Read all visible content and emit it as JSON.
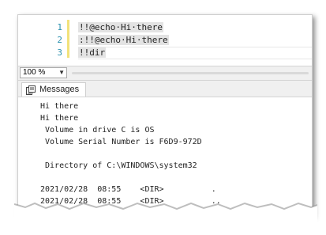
{
  "editor": {
    "line_numbers": [
      "1",
      "2",
      "3"
    ],
    "lines": [
      "!!@echo·Hi·there",
      ":!!@echo·Hi·there",
      "!!dir"
    ]
  },
  "zoom": {
    "value": "100 %"
  },
  "tabs": [
    {
      "label": "Messages",
      "icon": "messages-icon"
    }
  ],
  "output": {
    "lines": [
      "Hi there",
      "Hi there",
      " Volume in drive C is OS",
      " Volume Serial Number is F6D9-972D",
      "",
      " Directory of C:\\WINDOWS\\system32",
      "",
      "2021/02/28  08:55    <DIR>          .",
      "2021/02/28  08:55    <DIR>          .."
    ]
  },
  "colors": {
    "line_number": "#2b91af",
    "change_bar": "#f2e27a",
    "selection": "#e3e3e3"
  }
}
